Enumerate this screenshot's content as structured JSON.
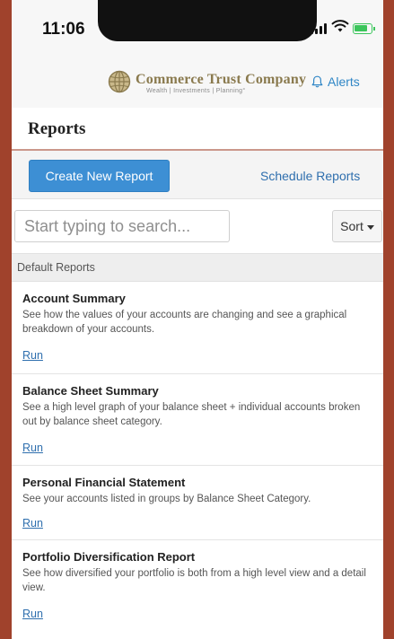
{
  "status_bar": {
    "time": "11:06"
  },
  "header": {
    "brand_name": "Commerce Trust Company",
    "brand_tagline": "Wealth  |  Investments  |  Planning°",
    "alerts_label": "Alerts"
  },
  "page": {
    "title": "Reports"
  },
  "actions": {
    "create_label": "Create New Report",
    "schedule_label": "Schedule Reports"
  },
  "search": {
    "placeholder": "Start typing to search...",
    "value": ""
  },
  "sort": {
    "label": "Sort"
  },
  "section": {
    "title": "Default Reports"
  },
  "reports": [
    {
      "title": "Account Summary",
      "description": "See how the values of your accounts are changing and see a graphical breakdown of your accounts.",
      "run_label": "Run"
    },
    {
      "title": "Balance Sheet Summary",
      "description": "See a high level graph of your balance sheet + individual accounts broken out by balance sheet category.",
      "run_label": "Run"
    },
    {
      "title": "Personal Financial Statement",
      "description": "See your accounts listed in groups by Balance Sheet Category.",
      "run_label": "Run"
    },
    {
      "title": "Portfolio Diversification Report",
      "description": "See how diversified your portfolio is both from a high level view and a detail view.",
      "run_label": "Run"
    }
  ],
  "colors": {
    "accent": "#3d8fd4",
    "link": "#2f6fae",
    "brand_gold": "#8a7a4e",
    "frame": "#a0422c"
  },
  "icons": {
    "alerts": "bell-icon",
    "logo": "globe-logo-icon",
    "sort": "caret-down-icon"
  }
}
